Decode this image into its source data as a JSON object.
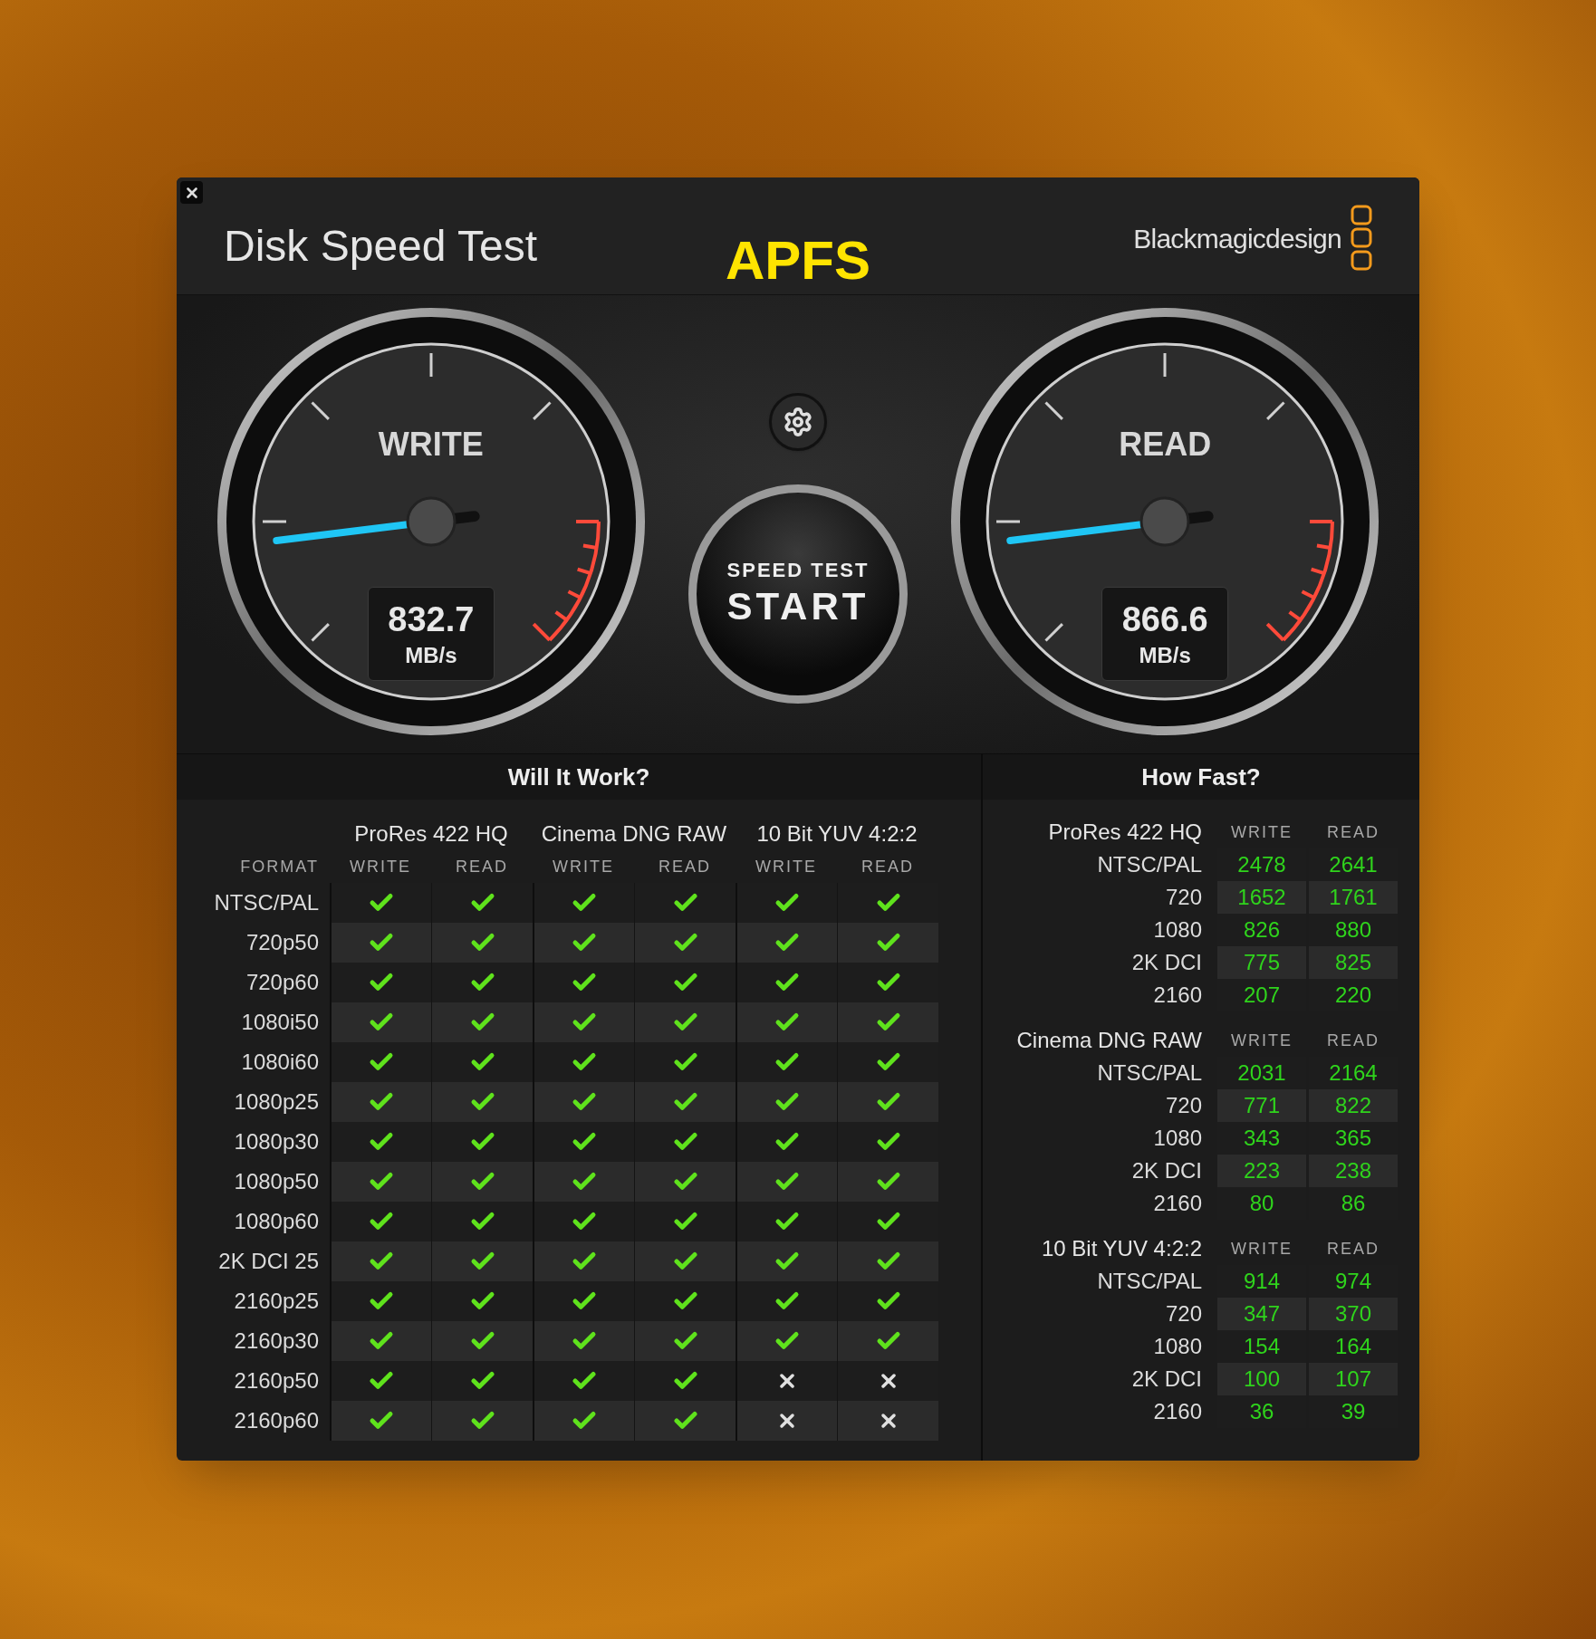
{
  "window": {
    "title": "Disk Speed Test",
    "volume": "APFS",
    "brand": "Blackmagicdesign"
  },
  "gauges": [
    {
      "label": "WRITE",
      "value": "832.7",
      "unit": "MB/s"
    },
    {
      "label": "READ",
      "value": "866.6",
      "unit": "MB/s"
    }
  ],
  "start_button": {
    "caption": "SPEED TEST",
    "label": "START"
  },
  "will_it_work": {
    "title": "Will It Work?",
    "format_header": "FORMAT",
    "groups": [
      {
        "name": "ProRes 422 HQ",
        "columns": [
          "WRITE",
          "READ"
        ]
      },
      {
        "name": "Cinema DNG RAW",
        "columns": [
          "WRITE",
          "READ"
        ]
      },
      {
        "name": "10 Bit YUV 4:2:2",
        "columns": [
          "WRITE",
          "READ"
        ]
      }
    ],
    "rows": [
      {
        "format": "NTSC/PAL",
        "ok": [
          true,
          true,
          true,
          true,
          true,
          true
        ]
      },
      {
        "format": "720p50",
        "ok": [
          true,
          true,
          true,
          true,
          true,
          true
        ]
      },
      {
        "format": "720p60",
        "ok": [
          true,
          true,
          true,
          true,
          true,
          true
        ]
      },
      {
        "format": "1080i50",
        "ok": [
          true,
          true,
          true,
          true,
          true,
          true
        ]
      },
      {
        "format": "1080i60",
        "ok": [
          true,
          true,
          true,
          true,
          true,
          true
        ]
      },
      {
        "format": "1080p25",
        "ok": [
          true,
          true,
          true,
          true,
          true,
          true
        ]
      },
      {
        "format": "1080p30",
        "ok": [
          true,
          true,
          true,
          true,
          true,
          true
        ]
      },
      {
        "format": "1080p50",
        "ok": [
          true,
          true,
          true,
          true,
          true,
          true
        ]
      },
      {
        "format": "1080p60",
        "ok": [
          true,
          true,
          true,
          true,
          true,
          true
        ]
      },
      {
        "format": "2K DCI 25",
        "ok": [
          true,
          true,
          true,
          true,
          true,
          true
        ]
      },
      {
        "format": "2160p25",
        "ok": [
          true,
          true,
          true,
          true,
          true,
          true
        ]
      },
      {
        "format": "2160p30",
        "ok": [
          true,
          true,
          true,
          true,
          true,
          true
        ]
      },
      {
        "format": "2160p50",
        "ok": [
          true,
          true,
          true,
          true,
          false,
          false
        ]
      },
      {
        "format": "2160p60",
        "ok": [
          true,
          true,
          true,
          true,
          false,
          false
        ]
      }
    ]
  },
  "how_fast": {
    "title": "How Fast?",
    "groups": [
      {
        "name": "ProRes 422 HQ",
        "write_header": "WRITE",
        "read_header": "READ",
        "rows": [
          {
            "label": "NTSC/PAL",
            "write": "2478",
            "read": "2641"
          },
          {
            "label": "720",
            "write": "1652",
            "read": "1761"
          },
          {
            "label": "1080",
            "write": "826",
            "read": "880"
          },
          {
            "label": "2K DCI",
            "write": "775",
            "read": "825"
          },
          {
            "label": "2160",
            "write": "207",
            "read": "220"
          }
        ]
      },
      {
        "name": "Cinema DNG RAW",
        "write_header": "WRITE",
        "read_header": "READ",
        "rows": [
          {
            "label": "NTSC/PAL",
            "write": "2031",
            "read": "2164"
          },
          {
            "label": "720",
            "write": "771",
            "read": "822"
          },
          {
            "label": "1080",
            "write": "343",
            "read": "365"
          },
          {
            "label": "2K DCI",
            "write": "223",
            "read": "238"
          },
          {
            "label": "2160",
            "write": "80",
            "read": "86"
          }
        ]
      },
      {
        "name": "10 Bit YUV 4:2:2",
        "write_header": "WRITE",
        "read_header": "READ",
        "rows": [
          {
            "label": "NTSC/PAL",
            "write": "914",
            "read": "974"
          },
          {
            "label": "720",
            "write": "347",
            "read": "370"
          },
          {
            "label": "1080",
            "write": "154",
            "read": "164"
          },
          {
            "label": "2K DCI",
            "write": "100",
            "read": "107"
          },
          {
            "label": "2160",
            "write": "36",
            "read": "39"
          }
        ]
      }
    ]
  }
}
